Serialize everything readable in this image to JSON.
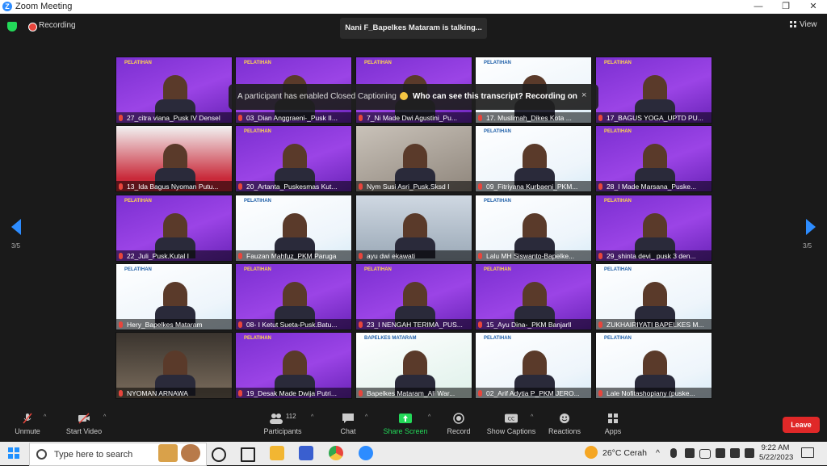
{
  "window": {
    "title": "Zoom Meeting",
    "minimize": "—",
    "maximize": "❐",
    "close": "✕"
  },
  "meeting": {
    "recording_label": "Recording",
    "talking": "Nani F_Bapelkes Mataram is talking...",
    "view_label": "View",
    "page_left": "3/5",
    "page_right": "3/5"
  },
  "caption_banner": {
    "message": "A participant has enabled Closed Captioning",
    "link": "Who can see this transcript? Recording on",
    "close": "×"
  },
  "tiles": [
    {
      "name": "27_citra viana_Pusk IV Densel",
      "style": "purple",
      "banner": "PELATIHAN"
    },
    {
      "name": "03_Dian Anggraeni-_Pusk II...",
      "style": "purple",
      "banner": "PELATIHAN"
    },
    {
      "name": "7_Ni Made Dwi Agustini_Pu...",
      "style": "purple",
      "banner": "PELATIHAN"
    },
    {
      "name": "17. Muslimah_Dikes Kota ...",
      "style": "white",
      "banner": "PELATIHAN"
    },
    {
      "name": "17_BAGUS YOGA_UPTD PU...",
      "style": "purple",
      "banner": "PELATIHAN"
    },
    {
      "name": "13_Ida Bagus Nyoman Putu...",
      "style": "pink",
      "banner": ""
    },
    {
      "name": "20_Artanta_Puskesmas Kut...",
      "style": "purple",
      "banner": "PELATIHAN"
    },
    {
      "name": "Nym Susi Asri_Pusk.Sksd I",
      "style": "photo",
      "banner": ""
    },
    {
      "name": "09_Fitriyana Kurbaeni_PKM...",
      "style": "white",
      "banner": "PELATIHAN"
    },
    {
      "name": "28_I Made Marsana_Puske...",
      "style": "purple",
      "banner": "PELATIHAN"
    },
    {
      "name": "22_Juli_Pusk.Kutal I",
      "style": "purple",
      "banner": "PELATIHAN"
    },
    {
      "name": "Fauzan Mahfuz_PKM Paruga",
      "style": "white",
      "banner": "PELATIHAN"
    },
    {
      "name": "ayu dwi ekawati",
      "style": "room",
      "banner": ""
    },
    {
      "name": "Lalu MH Siswanto-Bapelke...",
      "style": "white",
      "banner": "PELATIHAN"
    },
    {
      "name": "29_shinta devi_ pusk 3 den...",
      "style": "purple",
      "banner": "PELATIHAN"
    },
    {
      "name": "Hery_Bapelkes Mataram",
      "style": "white",
      "banner": "PELATIHAN"
    },
    {
      "name": "08- I Ketut Sueta-Pusk.Batu...",
      "style": "purple",
      "banner": "PELATIHAN"
    },
    {
      "name": "23_I NENGAH TERIMA_PUS...",
      "style": "purple",
      "banner": "PELATIHAN"
    },
    {
      "name": "15_Ayu Dina-_PKM Banjarll",
      "style": "purple",
      "banner": "PELATIHAN"
    },
    {
      "name": "ZUKHAIRIYATI BAPELKES M...",
      "style": "white",
      "banner": "PELATIHAN"
    },
    {
      "name": "NYOMAN ARNAWA",
      "style": "dark",
      "banner": ""
    },
    {
      "name": "19_Desak Made Dwija Putri...",
      "style": "purple",
      "banner": "PELATIHAN"
    },
    {
      "name": "Bapelkes Mataram_Ali War...",
      "style": "mixed",
      "banner": "BAPELKES MATARAM"
    },
    {
      "name": "02_Arif Adytia P_PKM JERO...",
      "style": "white",
      "banner": "PELATIHAN"
    },
    {
      "name": "Lale Nofitashopiany (puske...",
      "style": "white",
      "banner": "PELATIHAN"
    }
  ],
  "toolbar": {
    "unmute": "Unmute",
    "start_video": "Start Video",
    "participants": "Participants",
    "participant_count": "112",
    "chat": "Chat",
    "share_screen": "Share Screen",
    "record": "Record",
    "show_captions": "Show Captions",
    "reactions": "Reactions",
    "apps": "Apps",
    "leave": "Leave",
    "caret": "^"
  },
  "taskbar": {
    "search_placeholder": "Type here to search",
    "weather": "26°C  Cerah",
    "time": "9:22 AM",
    "date": "5/22/2023"
  },
  "colors": {
    "zoom_blue": "#2d8cff",
    "leave_red": "#e02828",
    "share_green": "#23d959",
    "recording_red": "#e8453c"
  }
}
